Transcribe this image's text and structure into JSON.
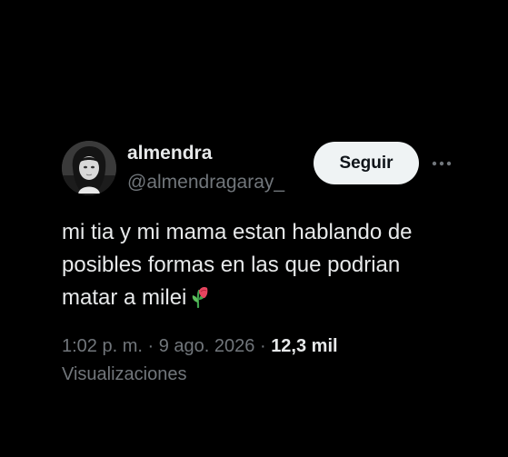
{
  "author": {
    "display_name": "almendra",
    "handle": "@almendragaray_",
    "avatar_icon": "avatar-photo"
  },
  "actions": {
    "follow_label": "Seguir",
    "more_icon": "more-horizontal-icon"
  },
  "tweet": {
    "lines": [
      "mi tia y mi mama estan hablando de",
      "posibles formas en las que podrian",
      "matar a milei"
    ],
    "emoji_icon": "wilted-flower-icon"
  },
  "meta": {
    "time": "1:02 p. m.",
    "separator": "·",
    "date": "9 ago. 2026",
    "views_count": "12,3 mil",
    "views_label": "Visualizaciones"
  },
  "colors": {
    "background": "#000000",
    "text_primary": "#e7e9ea",
    "text_secondary": "#71767b",
    "button_bg": "#eff3f4",
    "button_text": "#0f1419"
  }
}
